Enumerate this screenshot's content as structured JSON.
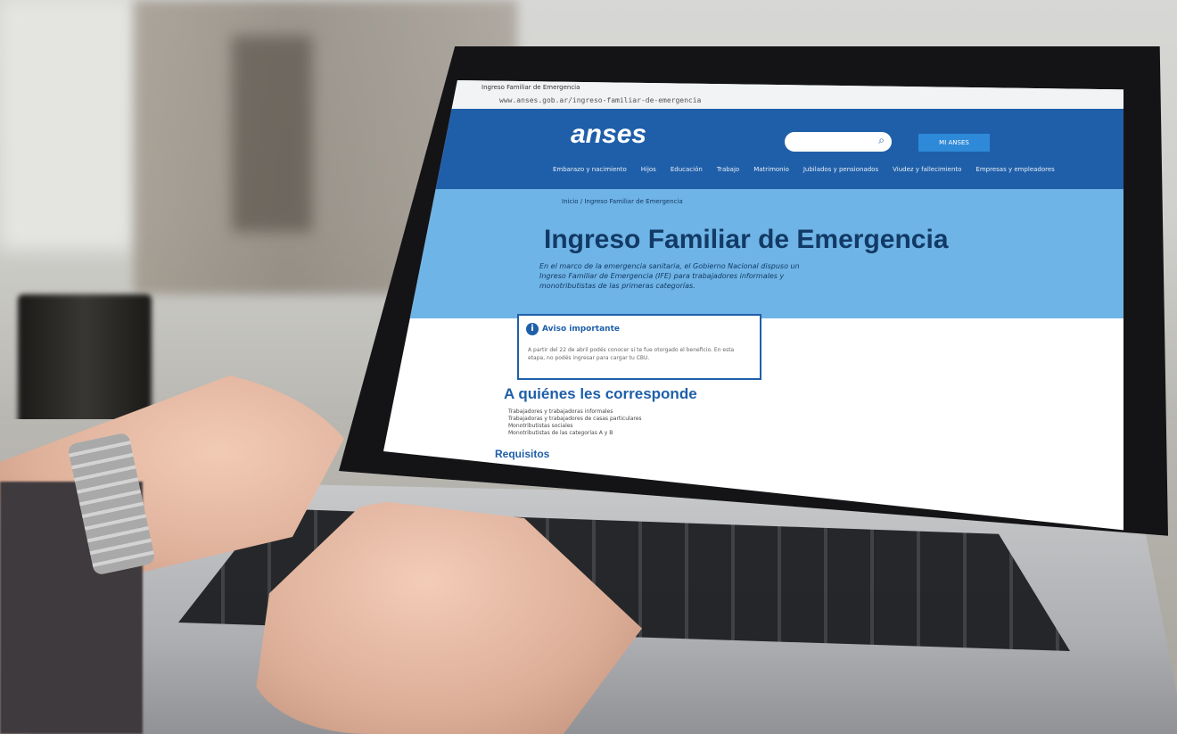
{
  "browser": {
    "tab_title": "Ingreso Familiar de Emergencia",
    "address": "www.anses.gob.ar/ingreso-familiar-de-emergencia"
  },
  "site": {
    "logo": "anses",
    "account_button": "MI ANSES",
    "nav": [
      "Embarazo y nacimiento",
      "Hijos",
      "Educación",
      "Trabajo",
      "Matrimonio",
      "Jubilados y pensionados",
      "Viudez y fallecimiento",
      "Empresas y empleadores"
    ]
  },
  "page": {
    "breadcrumb": "Inicio  /  Ingreso Familiar de Emergencia",
    "title": "Ingreso Familiar de Emergencia",
    "lead": "En el marco de la emergencia sanitaria, el Gobierno Nacional dispuso un Ingreso Familiar de Emergencia (IFE) para trabajadores informales y monotributistas de las primeras categorías.",
    "notice_title": "Aviso importante",
    "notice_body": "A partir del 22 de abril podés conocer si te fue otorgado el beneficio. En esta etapa, no podés ingresar para cargar tu CBU.",
    "section_title": "A quiénes les corresponde",
    "section_items": [
      "Trabajadores y trabajadoras informales",
      "Trabajadoras y trabajadores de casas particulares",
      "Monotributistas sociales",
      "Monotributistas de las categorías A y B"
    ],
    "next_section": "Requisitos"
  }
}
